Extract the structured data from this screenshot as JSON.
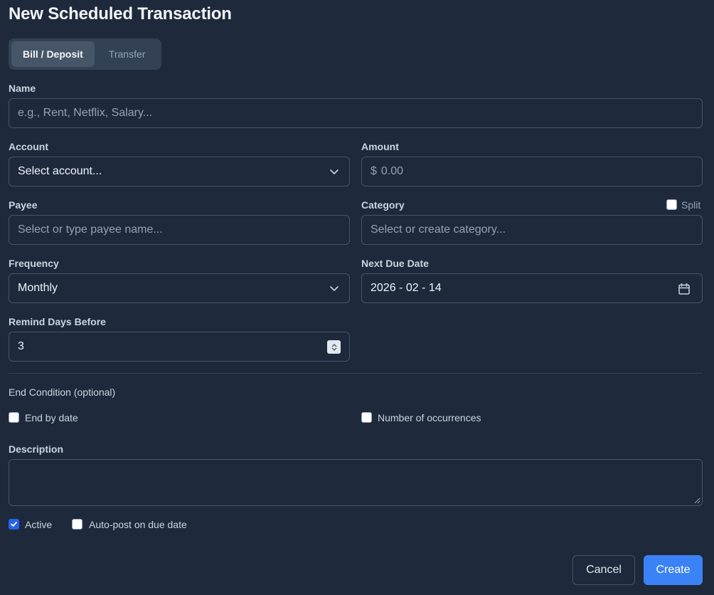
{
  "dialog": {
    "title": "New Scheduled Transaction"
  },
  "type_toggle": {
    "options": [
      "Bill / Deposit",
      "Transfer"
    ],
    "selected": "Bill / Deposit"
  },
  "fields": {
    "name": {
      "label": "Name",
      "value": "",
      "placeholder": "e.g., Rent, Netflix, Salary..."
    },
    "account": {
      "label": "Account",
      "value": "Select account..."
    },
    "amount": {
      "label": "Amount",
      "currency_symbol": "$",
      "placeholder": "0.00",
      "value": ""
    },
    "payee": {
      "label": "Payee",
      "placeholder": "Select or type payee name...",
      "value": ""
    },
    "category": {
      "label": "Category",
      "placeholder": "Select or create category...",
      "value": "",
      "split_label": "Split",
      "split_checked": false
    },
    "frequency": {
      "label": "Frequency",
      "value": "Monthly"
    },
    "next_due_date": {
      "label": "Next Due Date",
      "value": "2026 - 02 - 14"
    },
    "remind_days_before": {
      "label": "Remind Days Before",
      "value": "3"
    }
  },
  "end_condition": {
    "label": "End Condition (optional)",
    "end_by_date": {
      "label": "End by date",
      "checked": false
    },
    "occurrences": {
      "label": "Number of occurrences",
      "checked": false
    }
  },
  "description": {
    "label": "Description",
    "value": ""
  },
  "options": {
    "active": {
      "label": "Active",
      "checked": true
    },
    "auto_post": {
      "label": "Auto-post on due date",
      "checked": false
    }
  },
  "actions": {
    "cancel": "Cancel",
    "create": "Create"
  },
  "colors": {
    "background": "#1e293b",
    "accent": "#3b82f6",
    "border": "#475569"
  }
}
